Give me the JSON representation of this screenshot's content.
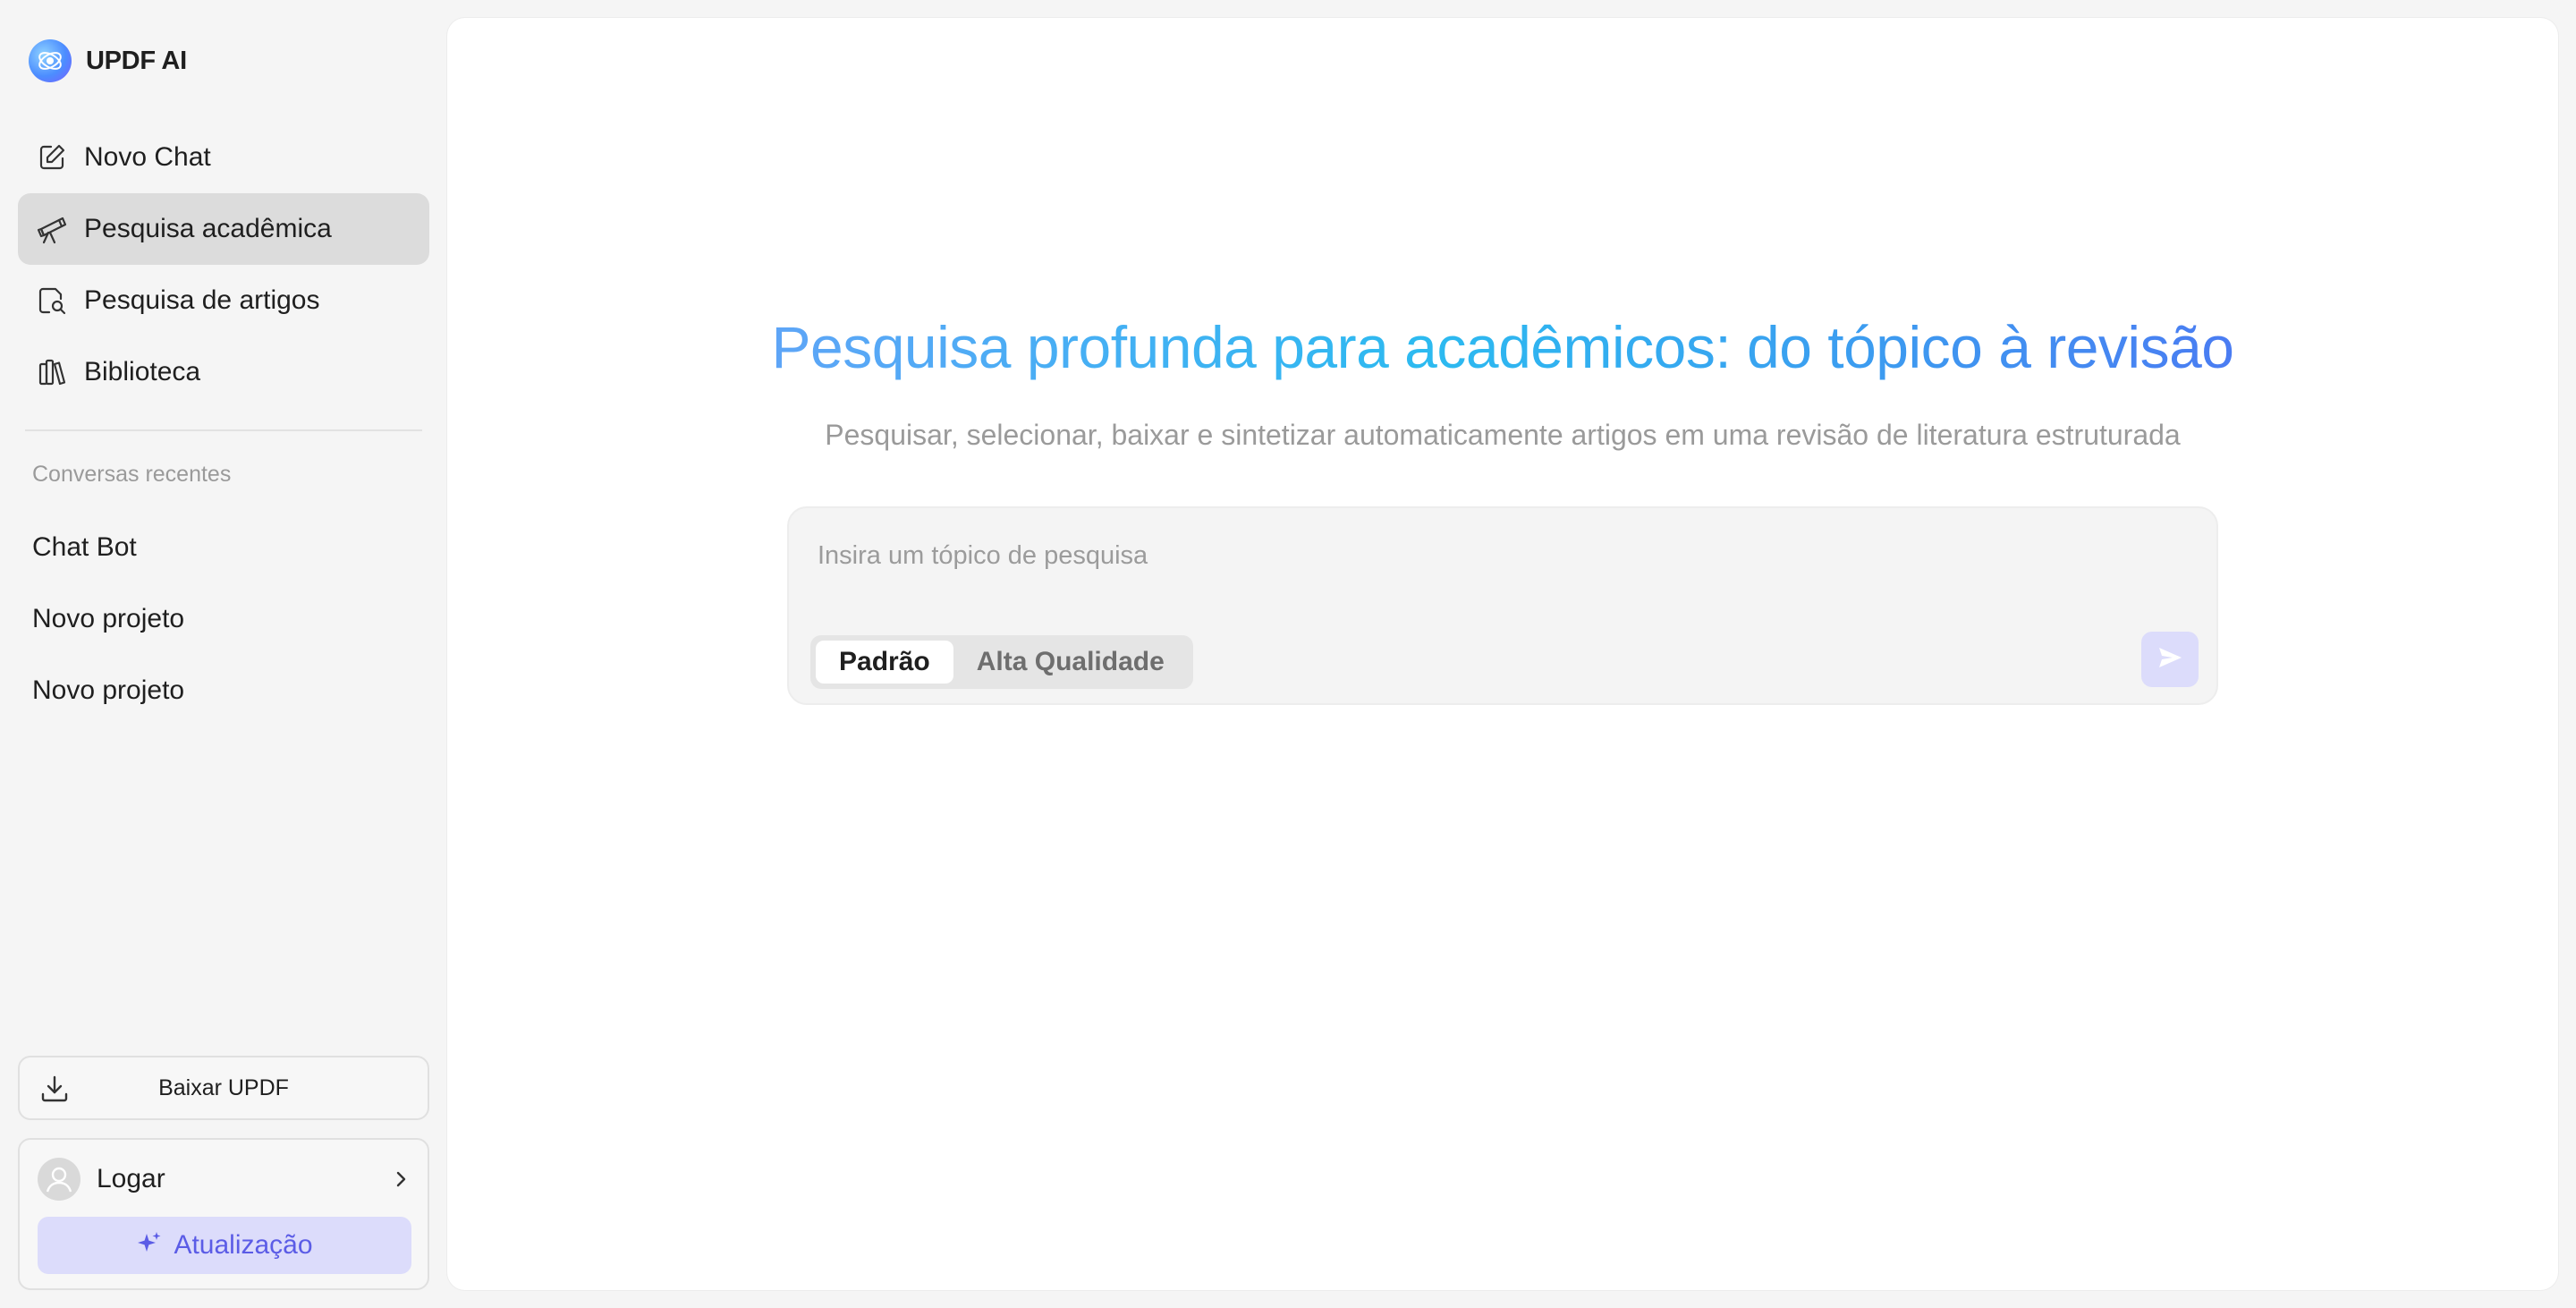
{
  "brand": {
    "name": "UPDF AI"
  },
  "nav": {
    "items": [
      {
        "label": "Novo Chat",
        "icon": "edit-icon",
        "active": false
      },
      {
        "label": "Pesquisa acadêmica",
        "icon": "telescope-icon",
        "active": true
      },
      {
        "label": "Pesquisa de artigos",
        "icon": "document-search-icon",
        "active": false
      },
      {
        "label": "Biblioteca",
        "icon": "library-icon",
        "active": false
      }
    ]
  },
  "recent": {
    "title": "Conversas recentes",
    "items": [
      {
        "label": "Chat Bot"
      },
      {
        "label": "Novo projeto"
      },
      {
        "label": "Novo projeto"
      }
    ]
  },
  "sidebar_footer": {
    "download_label": "Baixar UPDF",
    "login_label": "Logar",
    "upgrade_label": "Atualização"
  },
  "main": {
    "title": "Pesquisa profunda para acadêmicos: do tópico à revisão",
    "subtitle": "Pesquisar, selecionar, baixar e sintetizar automaticamente artigos em uma revisão de literatura estruturada",
    "composer": {
      "placeholder": "Insira um tópico de pesquisa",
      "value": "",
      "modes": [
        {
          "label": "Padrão",
          "selected": true
        },
        {
          "label": "Alta Qualidade",
          "selected": false
        }
      ]
    }
  },
  "colors": {
    "accent": "#5b5ce6",
    "accent_soft": "#dcdcfb",
    "title_gradient_start": "#5ea5f7",
    "title_gradient_end": "#4a7cf2",
    "active_nav": "#dcdcdc"
  }
}
